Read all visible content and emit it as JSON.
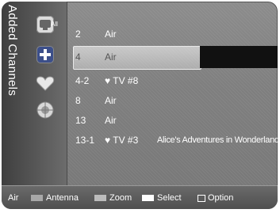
{
  "panel": {
    "title": "Added Channels",
    "icons": [
      {
        "name": "all-channels-icon",
        "label": "All"
      },
      {
        "name": "added-channels-icon"
      },
      {
        "name": "favorites-icon"
      },
      {
        "name": "programmed-icon"
      }
    ]
  },
  "channels": [
    {
      "number": "2",
      "type": "Air",
      "name": ""
    },
    {
      "number": "4",
      "type": "Air",
      "name": ""
    },
    {
      "number": "4-2",
      "type": "♥ TV #8",
      "name": ""
    },
    {
      "number": "8",
      "type": "Air",
      "name": ""
    },
    {
      "number": "13",
      "type": "Air",
      "name": ""
    },
    {
      "number": "13-1",
      "type": "♥ TV #3",
      "name": "Alice's Adventures in Wonderland"
    }
  ],
  "selected_index": 1,
  "footer": {
    "source": "Air",
    "antenna_label": "Antenna",
    "zoom_label": "Zoom",
    "select_label": "Select",
    "option_label": "Option"
  },
  "colors": {
    "background": "#7f7f7f",
    "panel": "#4a4a4a",
    "text": "#ffffff",
    "selected_text": "#555555"
  }
}
